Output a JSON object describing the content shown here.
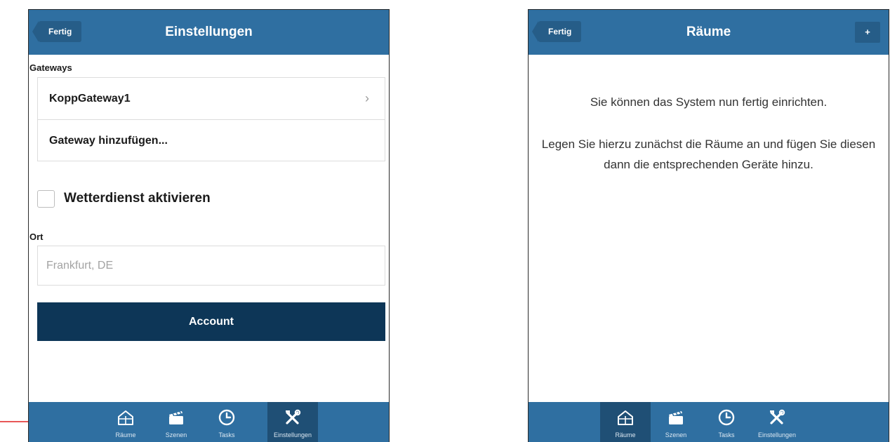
{
  "left_screen": {
    "header": {
      "back_label": "Fertig",
      "title": "Einstellungen"
    },
    "gateways": {
      "section_label": "Gateways",
      "items": [
        {
          "label": "KoppGateway1",
          "chevron": "›"
        },
        {
          "label": "Gateway hinzufügen..."
        }
      ]
    },
    "weather": {
      "label": "Wetterdienst aktivieren",
      "checked": false
    },
    "location": {
      "section_label": "Ort",
      "placeholder": "Frankfurt, DE"
    },
    "account_button": "Account",
    "active_tab": "Einstellungen"
  },
  "right_screen": {
    "header": {
      "back_label": "Fertig",
      "title": "Räume",
      "add_label": "+"
    },
    "message_line1": "Sie können das System nun fertig einrichten.",
    "message_line2": "Legen Sie hierzu zunächst die Räume an und fügen Sie diesen dann die entsprechenden Geräte hinzu.",
    "active_tab": "Räume"
  },
  "tabs": {
    "left": [
      {
        "label": "Räume",
        "icon": "house-icon"
      },
      {
        "label": "Szenen",
        "icon": "clapperboard-icon"
      },
      {
        "label": "Tasks",
        "icon": "clock-icon"
      },
      {
        "label": "Einstellungen",
        "icon": "tools-icon"
      }
    ],
    "right": [
      {
        "label": "Räume",
        "icon": "house-icon"
      },
      {
        "label": "Szenen",
        "icon": "clapperboard-icon"
      },
      {
        "label": "Tasks",
        "icon": "clock-icon"
      },
      {
        "label": "Einstellungen",
        "icon": "tools-icon"
      }
    ]
  },
  "colors": {
    "header_blue": "#2f6fa1",
    "active_tab": "#1f4f75",
    "account_button": "#0d3657",
    "annotation_arrow": "#e02020"
  }
}
